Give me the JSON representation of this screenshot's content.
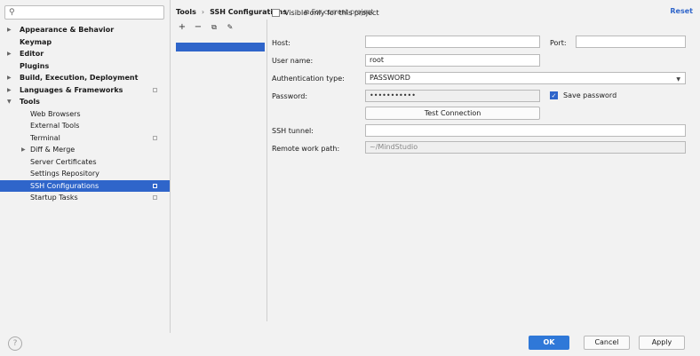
{
  "search": {
    "icon": "search-icon",
    "value": ""
  },
  "tree": [
    {
      "label": "Appearance & Behavior",
      "level": 0,
      "arrow": "▶",
      "badge": false,
      "selected": false
    },
    {
      "label": "Keymap",
      "level": 0,
      "arrow": "",
      "badge": false,
      "selected": false
    },
    {
      "label": "Editor",
      "level": 0,
      "arrow": "▶",
      "badge": false,
      "selected": false
    },
    {
      "label": "Plugins",
      "level": 0,
      "arrow": "",
      "badge": false,
      "selected": false
    },
    {
      "label": "Build, Execution, Deployment",
      "level": 0,
      "arrow": "▶",
      "badge": false,
      "selected": false
    },
    {
      "label": "Languages & Frameworks",
      "level": 0,
      "arrow": "▶",
      "badge": true,
      "selected": false
    },
    {
      "label": "Tools",
      "level": 0,
      "arrow": "▼",
      "badge": false,
      "selected": false
    },
    {
      "label": "Web Browsers",
      "level": 1,
      "arrow": "",
      "badge": false,
      "selected": false
    },
    {
      "label": "External Tools",
      "level": 1,
      "arrow": "",
      "badge": false,
      "selected": false
    },
    {
      "label": "Terminal",
      "level": 1,
      "arrow": "",
      "badge": true,
      "selected": false
    },
    {
      "label": "Diff & Merge",
      "level": 1,
      "arrow": "▶",
      "badge": false,
      "selected": false
    },
    {
      "label": "Server Certificates",
      "level": 1,
      "arrow": "",
      "badge": false,
      "selected": false
    },
    {
      "label": "Settings Repository",
      "level": 1,
      "arrow": "",
      "badge": false,
      "selected": false
    },
    {
      "label": "SSH Configurations",
      "level": 1,
      "arrow": "",
      "badge": true,
      "selected": true
    },
    {
      "label": "Startup Tasks",
      "level": 1,
      "arrow": "",
      "badge": true,
      "selected": false
    }
  ],
  "breadcrumb": {
    "parent": "Tools",
    "separator": "›",
    "current": "SSH Configurations",
    "scope": "For current project"
  },
  "reset_label": "Reset",
  "toolbar": {
    "add": "+",
    "remove": "−",
    "copy": "⧉",
    "edit": "✎"
  },
  "form": {
    "visible_only": {
      "label": "Visible only for this project",
      "checked": false
    },
    "host_label": "Host:",
    "host_value": "",
    "port_label": "Port:",
    "port_value": "",
    "username_label": "User name:",
    "username_value": "root",
    "auth_label": "Authentication type:",
    "auth_value": "PASSWORD",
    "password_label": "Password:",
    "password_value": "•••••••••••",
    "save_password": {
      "label": "Save password",
      "checked": true
    },
    "test_connection": "Test Connection",
    "ssh_tunnel_label": "SSH tunnel:",
    "ssh_tunnel_value": "",
    "remote_path_label": "Remote work path:",
    "remote_path_value": "~/MindStudio"
  },
  "footer": {
    "help": "?",
    "ok": "OK",
    "cancel": "Cancel",
    "apply": "Apply"
  },
  "colors": {
    "accent": "#2f65ca",
    "ok_button": "#2f78d8",
    "background": "#f2f2f2"
  }
}
